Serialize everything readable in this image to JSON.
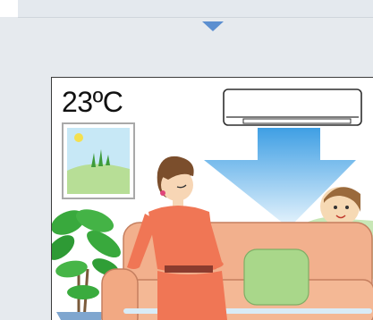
{
  "scene": {
    "temperature": "23ºC",
    "icons": [
      "down-arrow-icon",
      "air-conditioner-icon",
      "airflow-icon",
      "wall-picture-icon",
      "plant-icon",
      "sofa-icon",
      "woman-icon",
      "child-icon"
    ]
  },
  "colors": {
    "arrow": "#5c8fd0",
    "airflow_top": "#4aa6e6",
    "airflow_bottom": "#e7f4fc",
    "sofa": "#f2b08d",
    "dress": "#f07655",
    "cushion": "#a9d78a",
    "plant": "#39a93d"
  }
}
